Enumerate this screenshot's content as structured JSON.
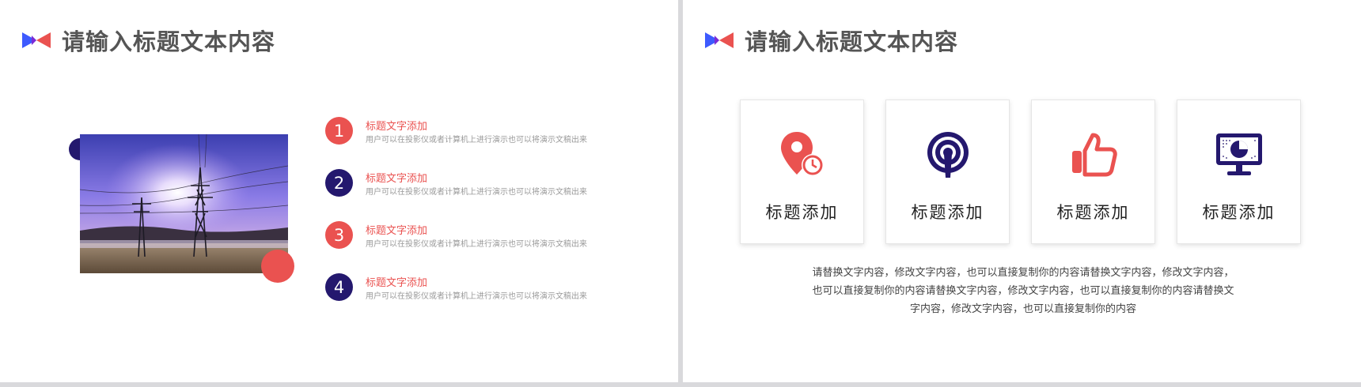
{
  "left_slide": {
    "title": "请输入标题文本内容",
    "items": [
      {
        "number": "1",
        "title": "标题文字添加",
        "desc": "用户可以在投影仪或者计算机上进行演示也可以将演示文稿出来"
      },
      {
        "number": "2",
        "title": "标题文字添加",
        "desc": "用户可以在投影仪或者计算机上进行演示也可以将演示文稿出来"
      },
      {
        "number": "3",
        "title": "标题文字添加",
        "desc": "用户可以在投影仪或者计算机上进行演示也可以将演示文稿出来"
      },
      {
        "number": "4",
        "title": "标题文字添加",
        "desc": "用户可以在投影仪或者计算机上进行演示也可以将演示文稿出来"
      }
    ]
  },
  "right_slide": {
    "title": "请输入标题文本内容",
    "cards": [
      {
        "icon": "location-clock-icon",
        "label": "标题添加"
      },
      {
        "icon": "broadcast-tower-icon",
        "label": "标题添加"
      },
      {
        "icon": "thumbs-up-icon",
        "label": "标题添加"
      },
      {
        "icon": "monitor-chart-icon",
        "label": "标题添加"
      }
    ],
    "paragraph_lines": [
      "请替换文字内容，修改文字内容，也可以直接复制你的内容请替换文字内容，修改文字内容，",
      "也可以直接复制你的内容请替换文字内容，修改文字内容，也可以直接复制你的内容请替换文",
      "字内容，修改文字内容，也可以直接复制你的内容"
    ]
  },
  "colors": {
    "red": "#ea5250",
    "navy": "#24186e",
    "logo_blue": "#3d5afe"
  }
}
